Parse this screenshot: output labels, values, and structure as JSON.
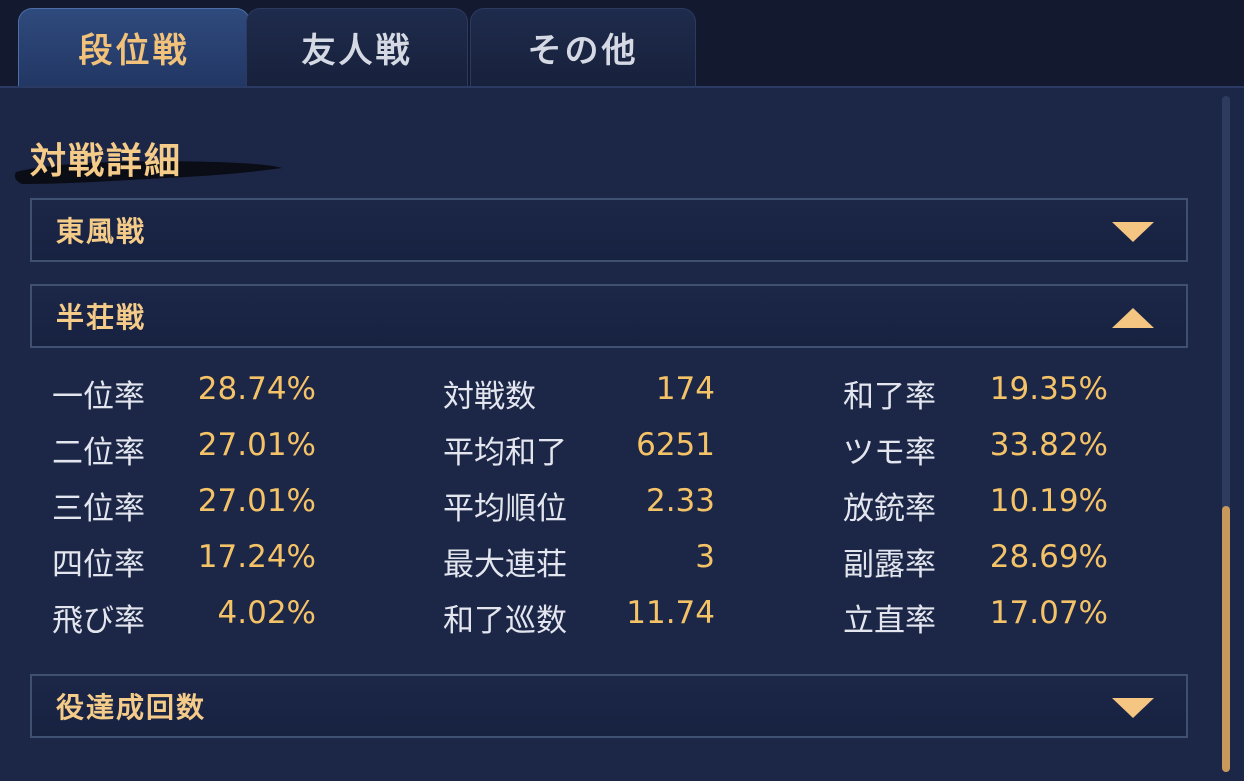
{
  "tabs": [
    {
      "label": "段位戦",
      "active": true
    },
    {
      "label": "友人戦",
      "active": false
    },
    {
      "label": "その他",
      "active": false
    }
  ],
  "section_title": "対戦詳細",
  "accordions": {
    "tonpuusen": {
      "label": "東風戦",
      "state": "collapsed"
    },
    "hanchansen": {
      "label": "半荘戦",
      "state": "expanded"
    },
    "yaku": {
      "label": "役達成回数",
      "state": "collapsed"
    }
  },
  "stats": {
    "col1": [
      {
        "label": "一位率",
        "value": "28.74%"
      },
      {
        "label": "二位率",
        "value": "27.01%"
      },
      {
        "label": "三位率",
        "value": "27.01%"
      },
      {
        "label": "四位率",
        "value": "17.24%"
      },
      {
        "label": "飛び率",
        "value": "4.02%"
      }
    ],
    "col2": [
      {
        "label": "対戦数",
        "value": "174"
      },
      {
        "label": "平均和了",
        "value": "6251"
      },
      {
        "label": "平均順位",
        "value": "2.33"
      },
      {
        "label": "最大連荘",
        "value": "3"
      },
      {
        "label": "和了巡数",
        "value": "11.74"
      }
    ],
    "col3": [
      {
        "label": "和了率",
        "value": "19.35%"
      },
      {
        "label": "ツモ率",
        "value": "33.82%"
      },
      {
        "label": "放銃率",
        "value": "10.19%"
      },
      {
        "label": "副露率",
        "value": "28.69%"
      },
      {
        "label": "立直率",
        "value": "17.07%"
      }
    ]
  },
  "colors": {
    "accent": "#f4cb88",
    "value": "#f5c367",
    "background": "#1c2646",
    "tab_active": "#2f4a7d"
  }
}
